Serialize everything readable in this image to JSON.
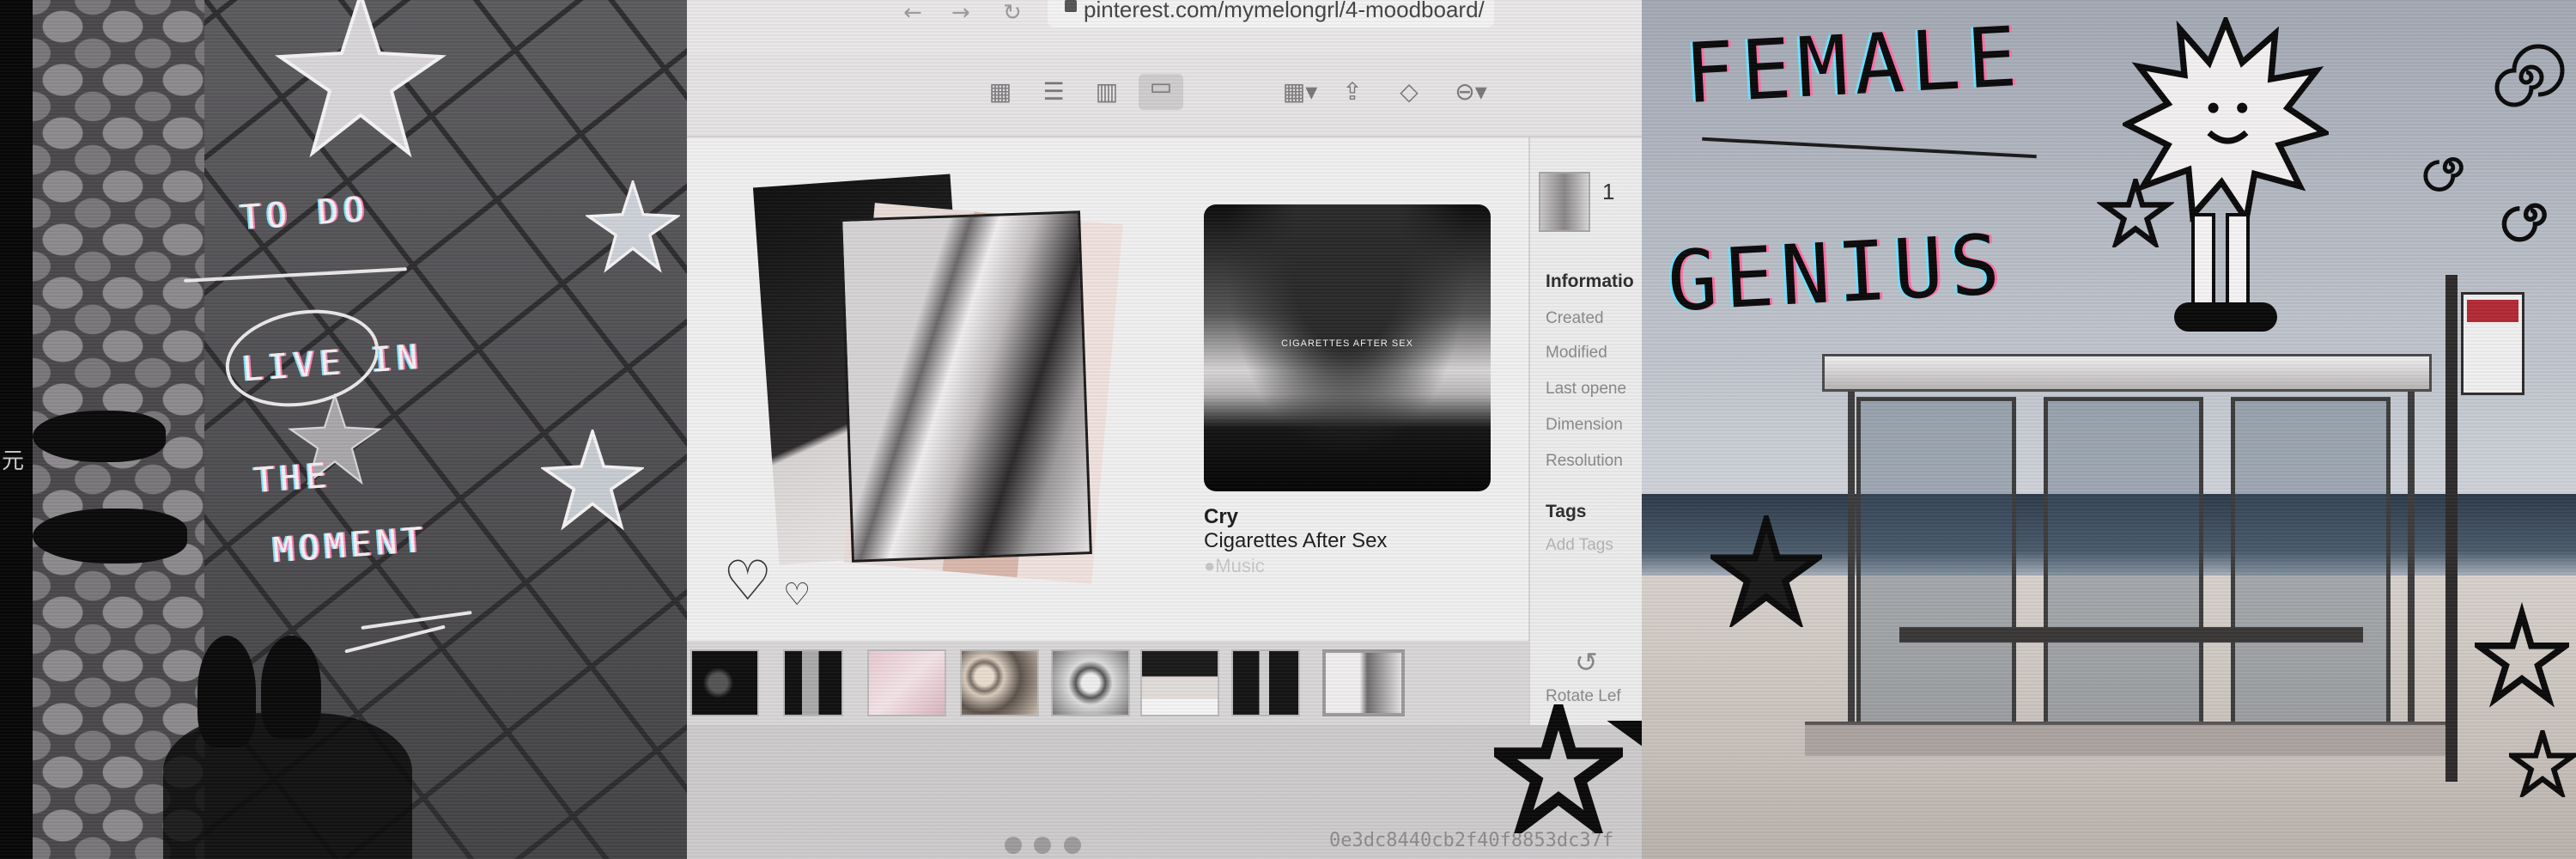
{
  "left_panel": {
    "margin_glyph": "元",
    "chalk_lines": [
      "TO DO",
      "LIVE IN",
      "THE",
      "MOMENT"
    ]
  },
  "browser": {
    "url": "pinterest.com/mymelongrl/4-moodboard/",
    "nav_icons": [
      "back-icon",
      "forward-icon",
      "reload-icon"
    ],
    "toolbar_icons": [
      "grid-view-icon",
      "list-view-icon",
      "column-view-icon",
      "gallery-view-icon",
      "group-icon",
      "share-icon",
      "tag-icon",
      "more-icon"
    ],
    "track": {
      "title": "Cry",
      "artist": "Cigarettes After Sex",
      "service": "Music",
      "cover_text": "CIGARETTES AFTER SEX"
    },
    "sidebar": {
      "number": "1",
      "information_heading": "Informatio",
      "rows": [
        "Created",
        "Modified",
        "Last opene",
        "Dimension",
        "Resolution"
      ],
      "tags_heading": "Tags",
      "tags_placeholder": "Add Tags",
      "rotate_label": "Rotate Lef"
    },
    "hash_text": "0e3dc8440cb2f40f8853dc37f"
  },
  "right_panel": {
    "doodle_top": "FEMALE",
    "doodle_bottom": "GENIUS"
  },
  "colors": {
    "accent_pink": "#ff6fa5",
    "accent_cyan": "#6fe2ff",
    "chalk_white": "#f4f0f2"
  }
}
